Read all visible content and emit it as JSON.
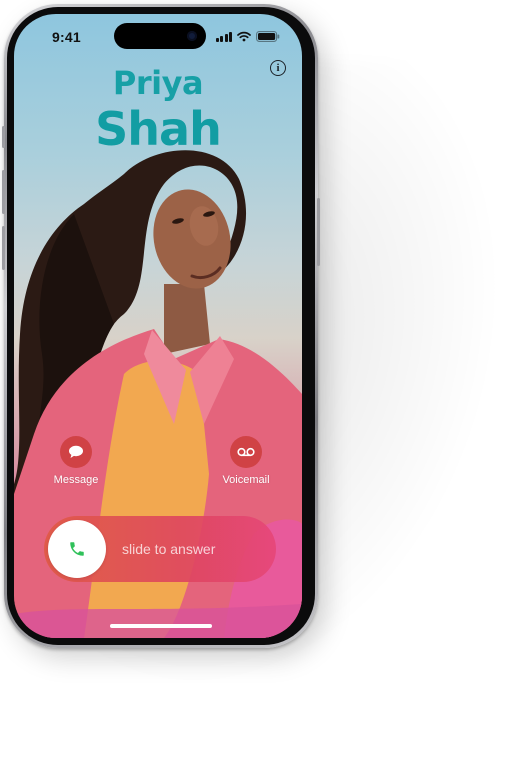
{
  "status_bar": {
    "time": "9:41"
  },
  "caller": {
    "first_name": "Priya",
    "last_name": "Shah"
  },
  "actions": {
    "message_label": "Message",
    "voicemail_label": "Voicemail"
  },
  "answer_slider": {
    "label": "slide to answer"
  },
  "colors": {
    "name_accent": "#129da3",
    "answer_green": "#30c15a",
    "action_red": "#cd3c3c"
  },
  "icons": [
    "info-icon",
    "message-bubble-icon",
    "voicemail-icon",
    "phone-icon",
    "signal-icon",
    "wifi-icon",
    "battery-icon"
  ]
}
